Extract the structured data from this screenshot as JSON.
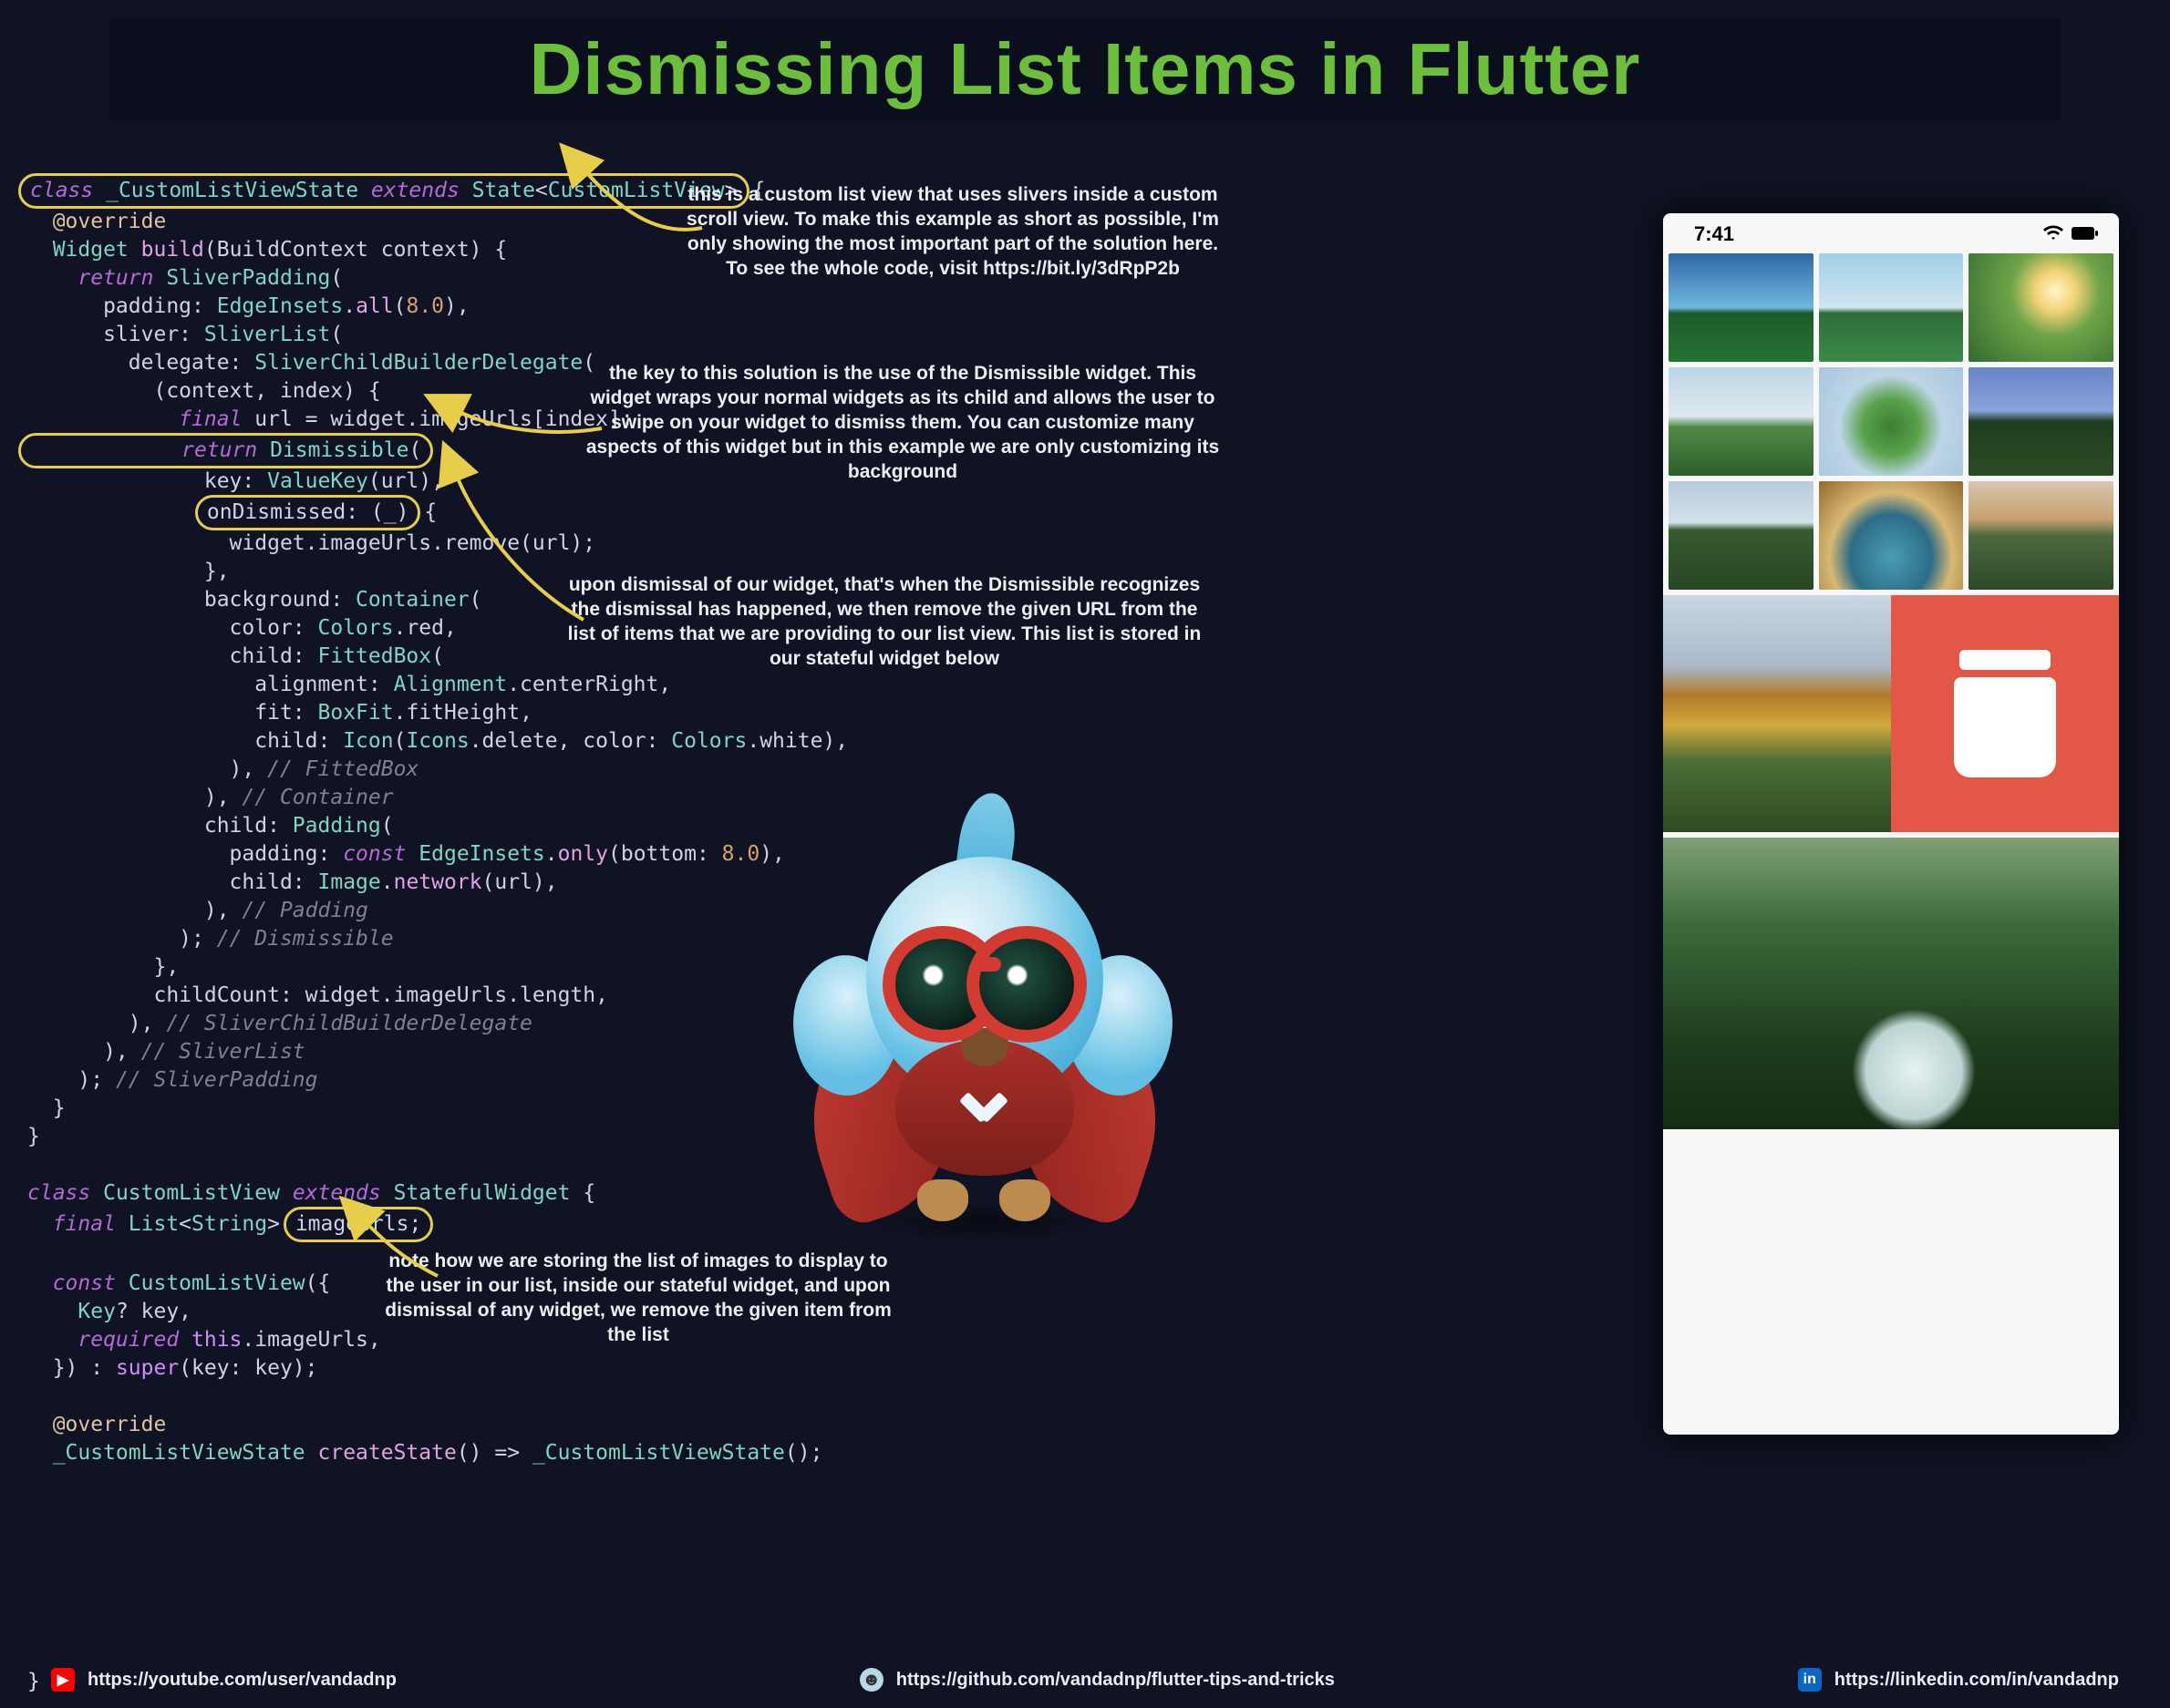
{
  "title": "Dismissing List Items in Flutter",
  "annotations": {
    "a1": "this is a custom list view that uses slivers inside a custom scroll view. To make this example as short as possible, I'm only showing the most important part of the solution here. To see the whole code, visit https://bit.ly/3dRpP2b",
    "a2": "the key to this solution is the use of the Dismissible widget. This widget wraps your normal widgets as its child and allows the user to swipe on your widget to dismiss them. You can customize many aspects of this widget but in this example we are only customizing its background",
    "a3": "upon dismissal of our widget, that's when the Dismissible recognizes the dismissal has happened, we then remove the given URL from the list of items that we are providing to our list view. This list is stored in our stateful widget below",
    "a4": "note how we are storing the list of images to display to the user in our list, inside our stateful widget, and upon dismissal of any widget, we remove the given item from the list"
  },
  "code": {
    "l01a": "class",
    "l01b": " _CustomListViewState ",
    "l01c": "extends",
    "l01d": " State",
    "l01e": "<",
    "l01f": "CustomListView",
    "l01g": ">",
    "l02": "  @override",
    "l03a": "  Widget ",
    "l03b": "build",
    "l03c": "(BuildContext context) {",
    "l04a": "    return ",
    "l04b": "SliverPadding",
    "l04c": "(",
    "l05a": "      padding: ",
    "l05b": "EdgeInsets",
    "l05c": ".",
    "l05d": "all",
    "l05e": "(",
    "l05f": "8.0",
    "l05g": "),",
    "l06a": "      sliver: ",
    "l06b": "SliverList",
    "l06c": "(",
    "l07a": "        delegate: ",
    "l07b": "SliverChildBuilderDelegate",
    "l07c": "(",
    "l08": "          (context, index) {",
    "l09a": "            final",
    "l09b": " url = widget.imageUrls[index];",
    "l10a": "            return ",
    "l10b": "Dismissible",
    "l10c": "(",
    "l11a": "              key: ",
    "l11b": "ValueKey",
    "l11c": "(url),",
    "l12a": "              onDismissed: ",
    "l12b": "(",
    "l12c": "_",
    "l12d": ")",
    "l12e": " {",
    "l13": "                widget.imageUrls.remove(url);",
    "l14": "              },",
    "l15a": "              background: ",
    "l15b": "Container",
    "l15c": "(",
    "l16a": "                color: ",
    "l16b": "Colors",
    "l16c": ".red,",
    "l17a": "                child: ",
    "l17b": "FittedBox",
    "l17c": "(",
    "l18a": "                  alignment: ",
    "l18b": "Alignment",
    "l18c": ".centerRight,",
    "l19a": "                  fit: ",
    "l19b": "BoxFit",
    "l19c": ".fitHeight,",
    "l20a": "                  child: ",
    "l20b": "Icon",
    "l20c": "(",
    "l20d": "Icons",
    "l20e": ".delete, color: ",
    "l20f": "Colors",
    "l20g": ".white),",
    "l21a": "                ), ",
    "l21b": "// FittedBox",
    "l22a": "              ), ",
    "l22b": "// Container",
    "l23a": "              child: ",
    "l23b": "Padding",
    "l23c": "(",
    "l24a": "                padding: ",
    "l24b": "const ",
    "l24c": "EdgeInsets",
    "l24d": ".",
    "l24e": "only",
    "l24f": "(bottom: ",
    "l24g": "8.0",
    "l24h": "),",
    "l25a": "                child: ",
    "l25b": "Image",
    "l25c": ".",
    "l25d": "network",
    "l25e": "(url),",
    "l26a": "              ), ",
    "l26b": "// Padding",
    "l27a": "            ); ",
    "l27b": "// Dismissible",
    "l28": "          },",
    "l29": "          childCount: widget.imageUrls.length,",
    "l30a": "        ), ",
    "l30b": "// SliverChildBuilderDelegate",
    "l31a": "      ), ",
    "l31b": "// SliverList",
    "l32a": "    ); ",
    "l32b": "// SliverPadding",
    "l33": "  }",
    "l34": "}",
    "l35": "",
    "l36a": "class ",
    "l36b": "CustomListView ",
    "l36c": "extends ",
    "l36d": "StatefulWidget ",
    "l36e": "{",
    "l37a": "  final ",
    "l37b": "List",
    "l37c": "<",
    "l37d": "String",
    "l37e": "> ",
    "l37f": "imageUrls;",
    "l38": "",
    "l39a": "  const ",
    "l39b": "CustomListView",
    "l39c": "({",
    "l40a": "    Key",
    "l40b": "? key,",
    "l41a": "    required ",
    "l41b": "this",
    ".l41c": ".imageUrls,",
    "l41c": ".imageUrls,",
    "l42a": "  }) : ",
    "l42b": "super",
    "l42c": "(key: key);",
    "l43": "",
    "l44": "  @override",
    "l45a": "  _CustomListViewState ",
    "l45b": "createState",
    "l45c": "() => ",
    "l45d": "_CustomListViewState",
    "l45e": "();"
  },
  "phone": {
    "time": "7:41",
    "delete_icon": "trash-icon"
  },
  "footer": {
    "youtube": "https://youtube.com/user/vandadnp",
    "github": "https://github.com/vandadnp/flutter-tips-and-tricks",
    "linkedin": "https://linkedin.com/in/vandadnp"
  }
}
